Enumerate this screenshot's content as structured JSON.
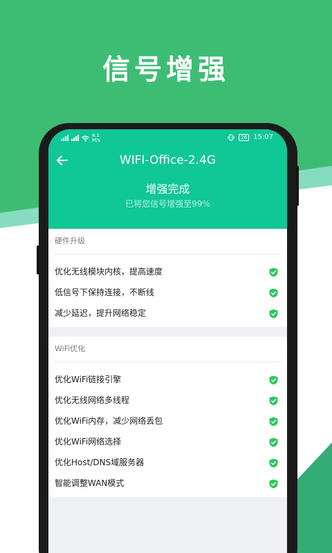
{
  "promo": {
    "headline": "信号增强"
  },
  "status_bar": {
    "left_indicators": "4.1",
    "left_unit": "M/s",
    "battery": "26",
    "time": "15:07"
  },
  "header": {
    "title": "WIFI-Office-2.4G",
    "status": "增强完成",
    "subtitle": "已将您信号增强至99%"
  },
  "sections": [
    {
      "title": "硬件升级",
      "items": [
        "优化无线模块内核，提高速度",
        "低信号下保持连接，不断线",
        "减少延迟，提升网络稳定"
      ]
    },
    {
      "title": "WiFi优化",
      "items": [
        "优化WiFi链接引擎",
        "优化无线网络多线程",
        "优化WiFi内存，减少网络丢包",
        "优化WiFi网络选择",
        "优化Host/DNS域服务器",
        "智能调整WAN模式"
      ]
    }
  ],
  "colors": {
    "brand_green": "#3dbd74",
    "header_teal": "#10c796",
    "check_green": "#2ec55f"
  },
  "icons": {
    "back": "back-arrow-icon",
    "check": "shield-check-icon"
  }
}
